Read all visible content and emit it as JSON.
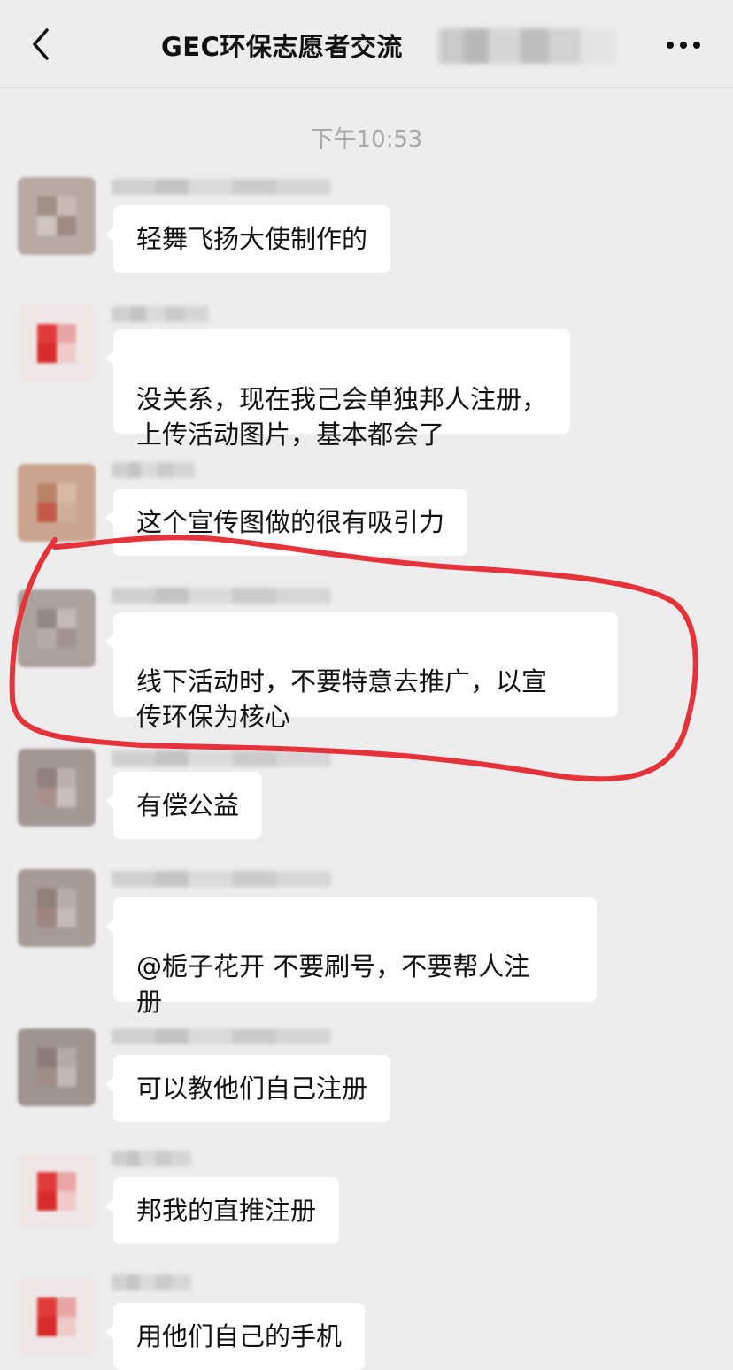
{
  "header": {
    "title": "GEC环保志愿者交流",
    "back_icon": "chevron-left-icon",
    "more_icon": "more-dots-icon"
  },
  "timestamp": "下午10:53",
  "messages": [
    {
      "text": "轻舞飞扬大使制作的"
    },
    {
      "text": "没关系，现在我己会单独邦人注册，\n上传活动图片，基本都会了"
    },
    {
      "text": "这个宣传图做的很有吸引力"
    },
    {
      "text": "线下活动时，不要特意去推广，以宣\n传环保为核心"
    },
    {
      "text": "有偿公益"
    },
    {
      "text": "@栀子花开 不要刷号，不要帮人注\n册"
    },
    {
      "text": "可以教他们自己注册"
    },
    {
      "text": "邦我的直推注册"
    },
    {
      "text": "用他们自己的手机"
    }
  ],
  "colors": {
    "background": "#ededed",
    "bubble": "#ffffff",
    "annotation_stroke": "#e5323b"
  }
}
